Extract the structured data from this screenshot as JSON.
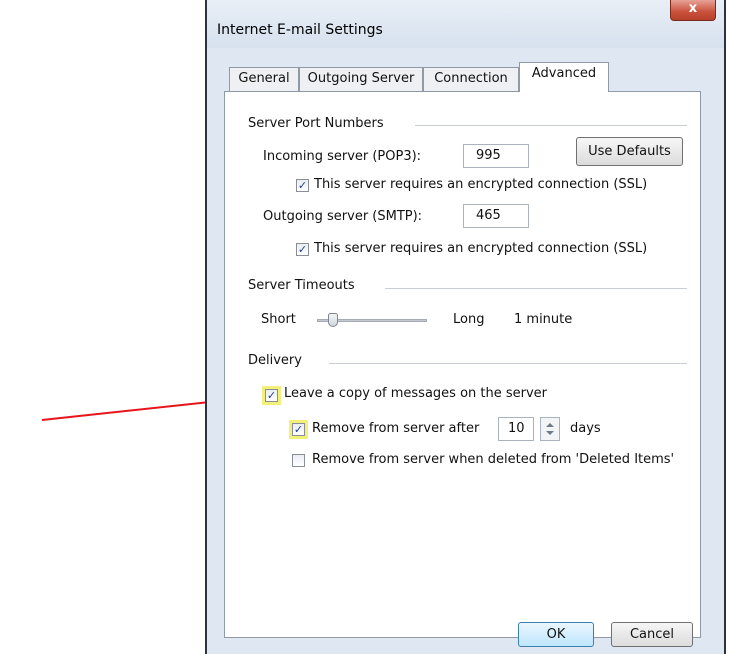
{
  "dialog": {
    "title": "Internet E-mail Settings",
    "close_label": "x",
    "tabs": [
      "General",
      "Outgoing Server",
      "Connection",
      "Advanced"
    ],
    "active_tab": "Advanced"
  },
  "server_ports": {
    "heading": "Server Port Numbers",
    "incoming_label": "Incoming server (POP3):",
    "incoming_value": "995",
    "use_defaults_label": "Use Defaults",
    "incoming_ssl_label": "This server requires an encrypted connection (SSL)",
    "incoming_ssl_checked": true,
    "outgoing_label": "Outgoing server (SMTP):",
    "outgoing_value": "465",
    "outgoing_ssl_label": "This server requires an encrypted connection (SSL)",
    "outgoing_ssl_checked": true
  },
  "timeouts": {
    "heading": "Server Timeouts",
    "short_label": "Short",
    "long_label": "Long",
    "value_label": "1 minute",
    "slider_position": 0.0
  },
  "delivery": {
    "heading": "Delivery",
    "leave_copy_label": "Leave a copy of messages on the server",
    "leave_copy_checked": true,
    "remove_after_label": "Remove from server after",
    "remove_after_checked": true,
    "remove_after_days": "10",
    "days_label": "days",
    "remove_deleted_label": "Remove from server when deleted from 'Deleted Items'",
    "remove_deleted_checked": false
  },
  "buttons": {
    "ok_label": "OK",
    "cancel_label": "Cancel"
  },
  "colors": {
    "annotation_arrow": "#e8141b",
    "highlight": "#f2f07a"
  }
}
